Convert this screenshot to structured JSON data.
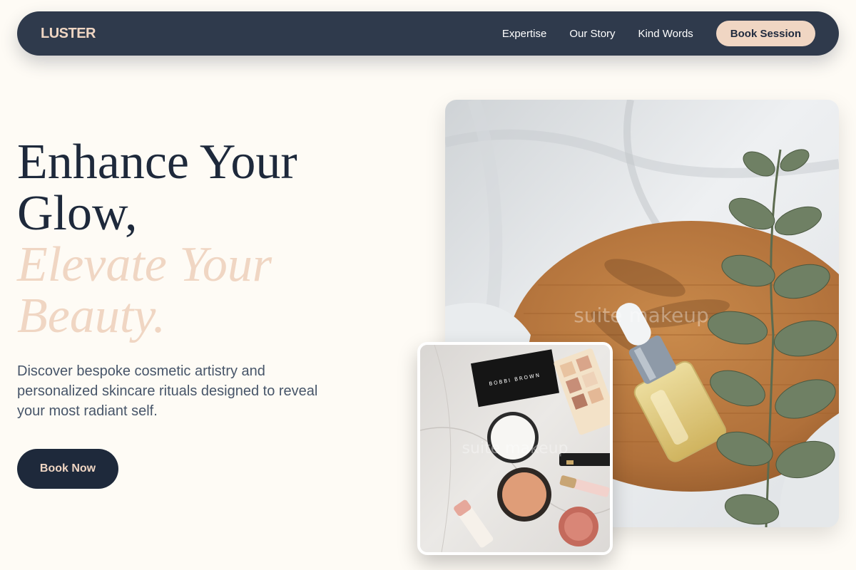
{
  "brand": {
    "logo": "LUSTER"
  },
  "nav": {
    "links": [
      "Expertise",
      "Our Story",
      "Kind Words"
    ],
    "cta": "Book Session"
  },
  "hero": {
    "title_line1": "Enhance Your",
    "title_line2": "Glow,",
    "accent_line1": "Elevate Your",
    "accent_line2": "Beauty.",
    "description": "Discover bespoke cosmetic artistry and personalized skincare rituals designed to reveal your most radiant self.",
    "cta": "Book Now"
  },
  "images": {
    "main_watermark": "suite makeup",
    "secondary_watermark": "suite makeup",
    "palette_brand": "BOBBI BROWN"
  },
  "colors": {
    "navbar": "#2f3a4c",
    "accent": "#f0d6c3",
    "heading": "#1e293b",
    "body_text": "#475569",
    "background": "#fefbf5"
  }
}
